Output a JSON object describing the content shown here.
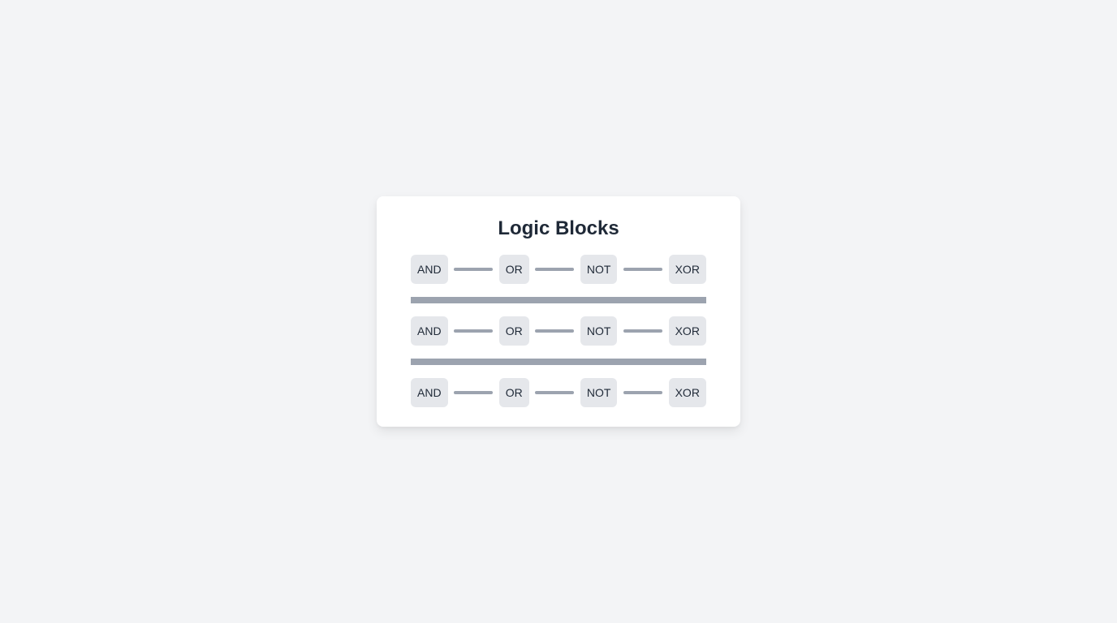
{
  "title": "Logic Blocks",
  "rows": [
    {
      "blocks": [
        "AND",
        "OR",
        "NOT",
        "XOR"
      ]
    },
    {
      "blocks": [
        "AND",
        "OR",
        "NOT",
        "XOR"
      ]
    },
    {
      "blocks": [
        "AND",
        "OR",
        "NOT",
        "XOR"
      ]
    }
  ],
  "colors": {
    "background": "#f3f4f6",
    "card": "#ffffff",
    "block": "#e5e7eb",
    "wire": "#9ca3af",
    "text": "#1f2937"
  }
}
